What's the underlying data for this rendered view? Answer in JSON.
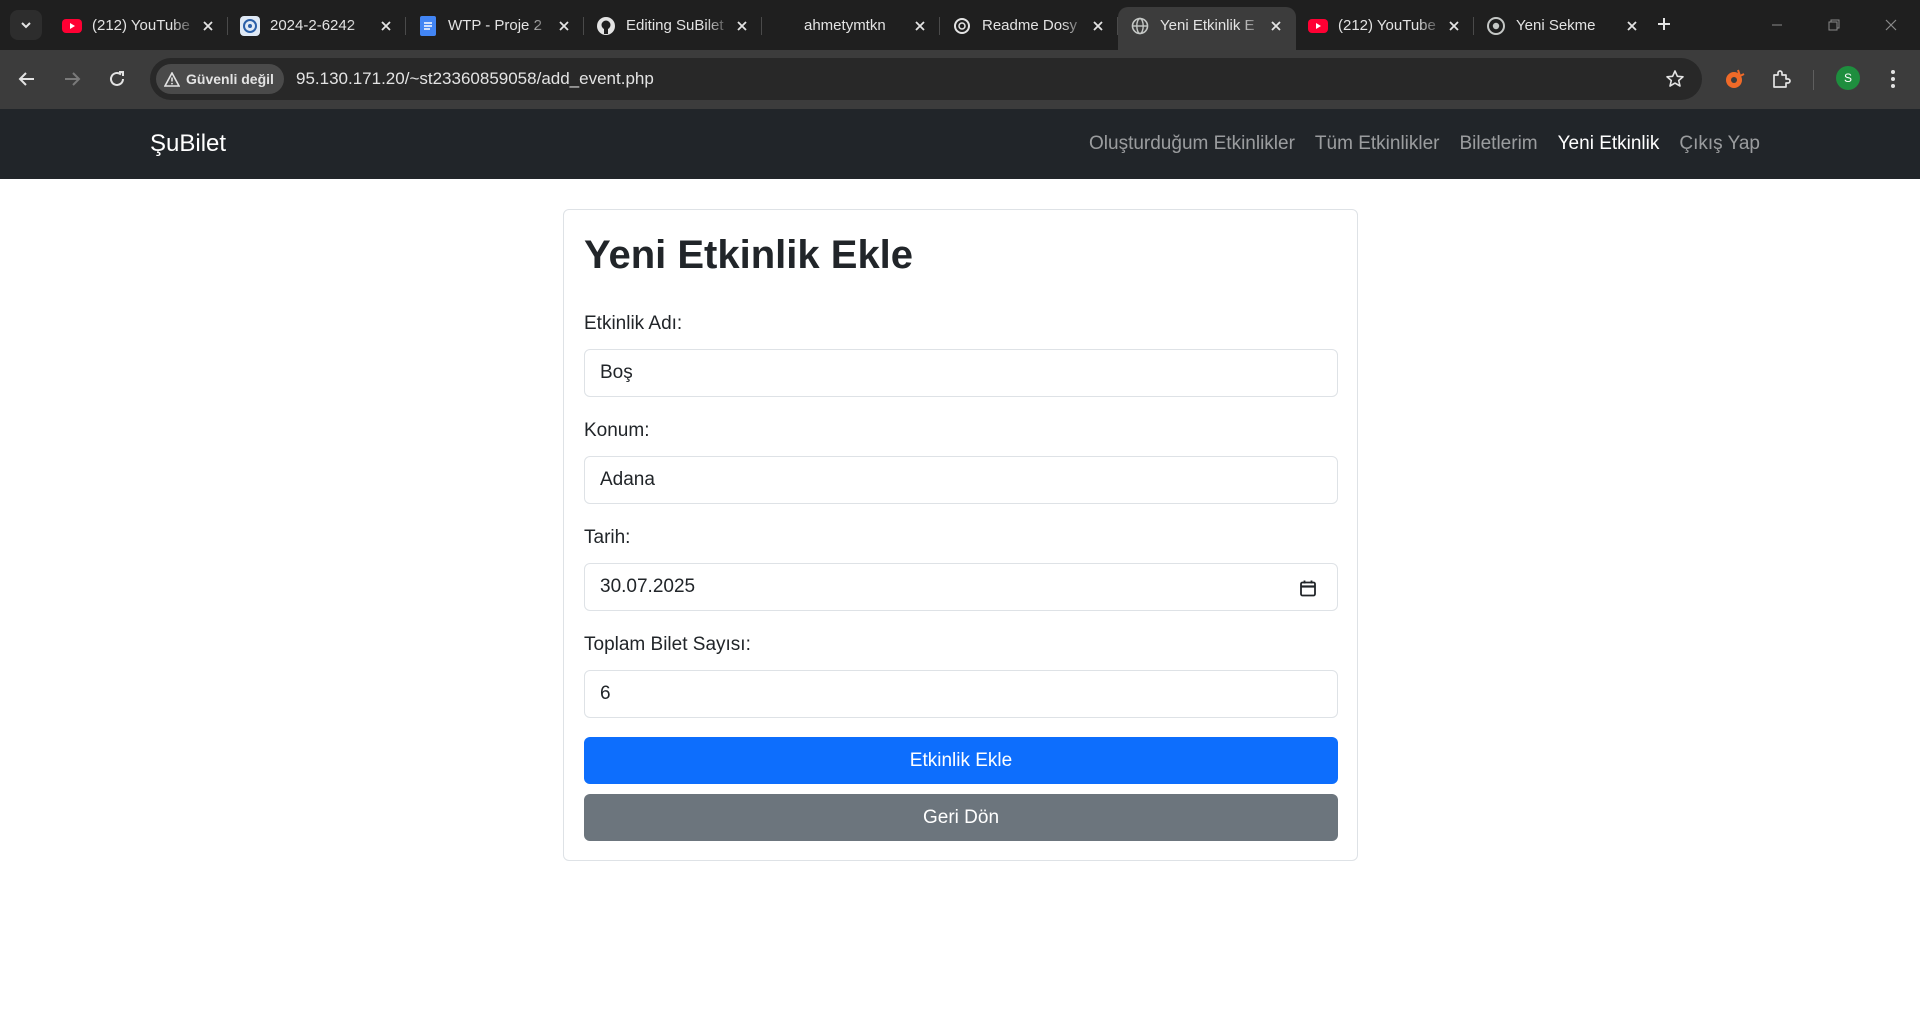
{
  "browser": {
    "tabs": [
      {
        "title": "(212) YouTube",
        "icon": "youtube-icon",
        "active": false
      },
      {
        "title": "2024-2-6242",
        "icon": "university-icon",
        "active": false
      },
      {
        "title": "WTP - Proje 2",
        "icon": "docs-icon",
        "active": false
      },
      {
        "title": "Editing SuBilet",
        "icon": "github-icon",
        "active": false
      },
      {
        "title": "ahmetymtkn",
        "icon": "blank-icon",
        "active": false
      },
      {
        "title": "Readme Dosy",
        "icon": "openai-icon",
        "active": false
      },
      {
        "title": "Yeni Etkinlik E",
        "icon": "globe-icon",
        "active": true
      },
      {
        "title": "(212) YouTube",
        "icon": "youtube-icon",
        "active": false
      },
      {
        "title": "Yeni Sekme",
        "icon": "chrome-icon",
        "active": false
      }
    ],
    "security_label": "Güvenli değil",
    "url": "95.130.171.20/~st23360859058/add_event.php",
    "profile_initial": "S",
    "colors": {
      "youtube": "#ff0033",
      "extension": "#f06a28",
      "profile": "#1e8e3e"
    }
  },
  "navbar": {
    "brand": "ŞuBilet",
    "links": [
      {
        "label": "Oluşturduğum Etkinlikler",
        "active": false
      },
      {
        "label": "Tüm Etkinlikler",
        "active": false
      },
      {
        "label": "Biletlerim",
        "active": false
      },
      {
        "label": "Yeni Etkinlik",
        "active": true
      },
      {
        "label": "Çıkış Yap",
        "active": false
      }
    ]
  },
  "form": {
    "title": "Yeni Etkinlik Ekle",
    "fields": [
      {
        "label": "Etkinlik Adı:",
        "value": "Boş"
      },
      {
        "label": "Konum:",
        "value": "Adana"
      },
      {
        "label": "Tarih:",
        "value": "30.07.2025"
      },
      {
        "label": "Toplam Bilet Sayısı:",
        "value": "6"
      }
    ],
    "submit_label": "Etkinlik Ekle",
    "back_label": "Geri Dön",
    "colors": {
      "primary": "#0d6efd",
      "secondary": "#6c757d",
      "navbar": "#212529"
    }
  }
}
